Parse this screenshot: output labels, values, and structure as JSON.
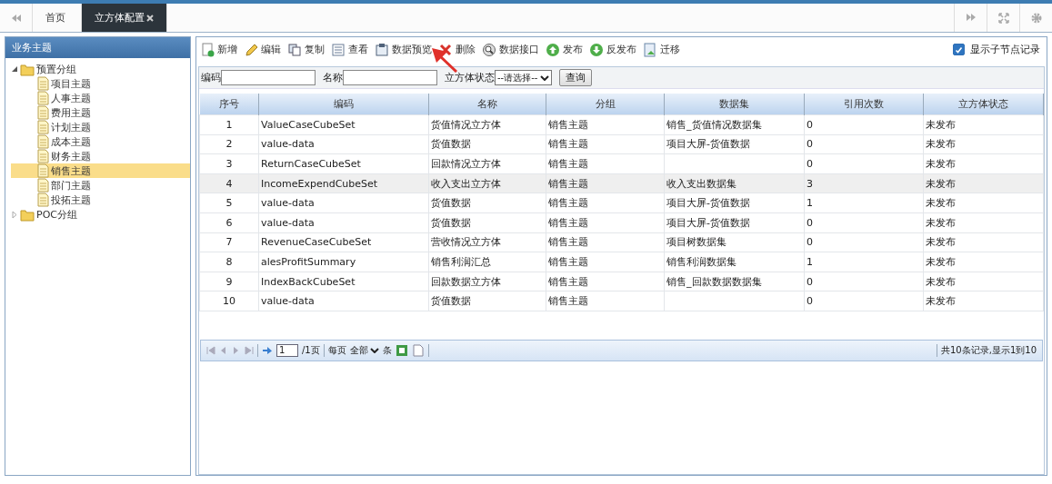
{
  "tabs": [
    {
      "label": "首页",
      "selected": false,
      "closable": false
    },
    {
      "label": "立方体配置",
      "selected": true,
      "closable": true
    }
  ],
  "sidebar": {
    "title": "业务主题",
    "tree": [
      {
        "label": "预置分组",
        "expanded": true,
        "children": [
          {
            "label": "项目主题",
            "selected": false
          },
          {
            "label": "人事主题",
            "selected": false
          },
          {
            "label": "费用主题",
            "selected": false
          },
          {
            "label": "计划主题",
            "selected": false
          },
          {
            "label": "成本主题",
            "selected": false
          },
          {
            "label": "财务主题",
            "selected": false
          },
          {
            "label": "销售主题",
            "selected": true
          },
          {
            "label": "部门主题",
            "selected": false
          },
          {
            "label": "投拓主题",
            "selected": false
          }
        ]
      },
      {
        "label": "POC分组",
        "expanded": false
      }
    ]
  },
  "toolbar": {
    "buttons": [
      {
        "label": "新增",
        "kind": "new"
      },
      {
        "label": "编辑",
        "kind": "edit"
      },
      {
        "label": "复制",
        "kind": "copy"
      },
      {
        "label": "查看",
        "kind": "view"
      },
      {
        "label": "数据预览",
        "kind": "preview"
      },
      {
        "label": "删除",
        "kind": "delete"
      },
      {
        "label": "数据接口",
        "kind": "api"
      },
      {
        "label": "发布",
        "kind": "publish"
      },
      {
        "label": "反发布",
        "kind": "unpublish"
      },
      {
        "label": "迁移",
        "kind": "migrate"
      }
    ],
    "show_children": {
      "label": "显示子节点记录",
      "checked": true
    }
  },
  "filters": {
    "code_label": "编码",
    "name_label": "名称",
    "status_label": "立方体状态",
    "status_select": "--请选择--",
    "query_button": "查询"
  },
  "table": {
    "columns": [
      "序号",
      "编码",
      "名称",
      "分组",
      "数据集",
      "引用次数",
      "立方体状态"
    ],
    "rows": [
      {
        "cells": [
          "1",
          "ValueCaseCubeSet",
          "货值情况立方体",
          "销售主题",
          "销售_货值情况数据集",
          "0",
          "未发布"
        ],
        "selected": false
      },
      {
        "cells": [
          "2",
          "value-data",
          "货值数据",
          "销售主题",
          "项目大屏-货值数据",
          "0",
          "未发布"
        ],
        "selected": false
      },
      {
        "cells": [
          "3",
          "ReturnCaseCubeSet",
          "回款情况立方体",
          "销售主题",
          "",
          "0",
          "未发布"
        ],
        "selected": false
      },
      {
        "cells": [
          "4",
          "IncomeExpendCubeSet",
          "收入支出立方体",
          "销售主题",
          "收入支出数据集",
          "3",
          "未发布"
        ],
        "selected": true
      },
      {
        "cells": [
          "5",
          "value-data",
          "货值数据",
          "销售主题",
          "项目大屏-货值数据",
          "1",
          "未发布"
        ],
        "selected": false
      },
      {
        "cells": [
          "6",
          "value-data",
          "货值数据",
          "销售主题",
          "项目大屏-货值数据",
          "0",
          "未发布"
        ],
        "selected": false
      },
      {
        "cells": [
          "7",
          "RevenueCaseCubeSet",
          "营收情况立方体",
          "销售主题",
          "项目树数据集",
          "0",
          "未发布"
        ],
        "selected": false
      },
      {
        "cells": [
          "8",
          "alesProfitSummary",
          "销售利润汇总",
          "销售主题",
          "销售利润数据集",
          "1",
          "未发布"
        ],
        "selected": false
      },
      {
        "cells": [
          "9",
          "IndexBackCubeSet",
          "回款数据立方体",
          "销售主题",
          "销售_回款数据数据集",
          "0",
          "未发布"
        ],
        "selected": false
      },
      {
        "cells": [
          "10",
          "value-data",
          "货值数据",
          "销售主题",
          "",
          "0",
          "未发布"
        ],
        "selected": false
      }
    ]
  },
  "pager": {
    "page_input": "1",
    "page_total": "/1页",
    "per_page_label": "每页",
    "per_page_select": "全部",
    "per_page_unit": "条",
    "summary": "共10条记录,显示1到10"
  }
}
